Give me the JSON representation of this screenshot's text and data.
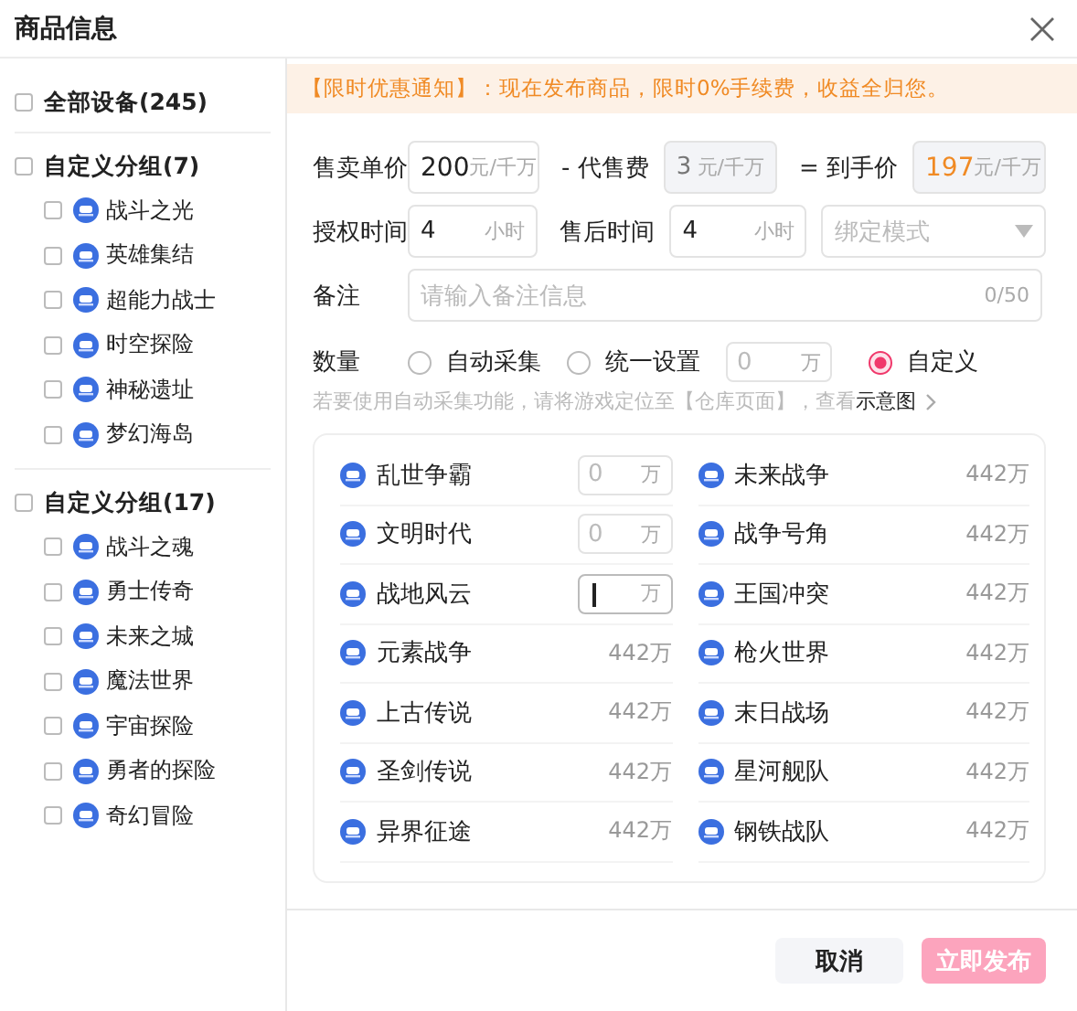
{
  "window": {
    "title": "商品信息"
  },
  "sidebar": {
    "all": {
      "label": "全部设备(245)",
      "checked": false
    },
    "groups": [
      {
        "label": "自定义分组(7)",
        "checked": false,
        "children": [
          {
            "label": "战斗之光",
            "checked": false
          },
          {
            "label": "英雄集结",
            "checked": false
          },
          {
            "label": "超能力战士",
            "checked": false
          },
          {
            "label": "时空探险",
            "checked": false
          },
          {
            "label": "神秘遗址",
            "checked": false
          },
          {
            "label": "梦幻海岛",
            "checked": false
          }
        ]
      },
      {
        "label": "自定义分组(17)",
        "checked": false,
        "children": [
          {
            "label": "战斗之魂",
            "checked": false
          },
          {
            "label": "勇士传奇",
            "checked": false
          },
          {
            "label": "未来之城",
            "checked": false
          },
          {
            "label": "魔法世界",
            "checked": false
          },
          {
            "label": "宇宙探险",
            "checked": false
          },
          {
            "label": "勇者的探险",
            "checked": false
          },
          {
            "label": "奇幻冒险",
            "checked": false
          }
        ]
      }
    ]
  },
  "notice": "【限时优惠通知】：现在发布商品，限时0%手续费，收益全归您。",
  "form": {
    "price": {
      "label": "售卖单价",
      "value": "200",
      "unit": "元/千万"
    },
    "fee": {
      "label": "- 代售费",
      "value": "3",
      "unit": "元/千万",
      "disabled": true
    },
    "net": {
      "label": "= 到手价",
      "value": "197",
      "unit": "元/千万",
      "disabled": true
    },
    "auth_time": {
      "label": "授权时间",
      "value": "4",
      "unit": "小时"
    },
    "after_sale": {
      "label": "售后时间",
      "value": "4",
      "unit": "小时"
    },
    "binding": {
      "placeholder": "绑定模式"
    },
    "remark": {
      "label": "备注",
      "placeholder": "请输入备注信息",
      "counter": "0/50"
    },
    "quantity": {
      "label": "数量",
      "options": [
        {
          "label": "自动采集",
          "selected": false
        },
        {
          "label": "统一设置",
          "selected": false,
          "input": {
            "placeholder": "0",
            "unit": "万"
          }
        },
        {
          "label": "自定义",
          "selected": true
        }
      ]
    },
    "hint": {
      "text": "若要使用自动采集功能，请将游戏定位至【仓库页面】，查看",
      "link": "示意图"
    }
  },
  "devices": [
    {
      "name": "乱世争霸",
      "kind": "input",
      "placeholder": "0",
      "unit": "万",
      "focused": false
    },
    {
      "name": "未来战争",
      "kind": "amount",
      "amount": "442万"
    },
    {
      "name": "文明时代",
      "kind": "input",
      "placeholder": "0",
      "unit": "万",
      "focused": false
    },
    {
      "name": "战争号角",
      "kind": "amount",
      "amount": "442万"
    },
    {
      "name": "战地风云",
      "kind": "input",
      "unit": "万",
      "focused": true
    },
    {
      "name": "王国冲突",
      "kind": "amount",
      "amount": "442万"
    },
    {
      "name": "元素战争",
      "kind": "amount",
      "amount": "442万"
    },
    {
      "name": "枪火世界",
      "kind": "amount",
      "amount": "442万"
    },
    {
      "name": "上古传说",
      "kind": "amount",
      "amount": "442万"
    },
    {
      "name": "末日战场",
      "kind": "amount",
      "amount": "442万"
    },
    {
      "name": "圣剑传说",
      "kind": "amount",
      "amount": "442万"
    },
    {
      "name": "星河舰队",
      "kind": "amount",
      "amount": "442万"
    },
    {
      "name": "异界征途",
      "kind": "amount",
      "amount": "442万"
    },
    {
      "name": "钢铁战队",
      "kind": "amount",
      "amount": "442万"
    }
  ],
  "buttons": [
    {
      "label": "取消",
      "kind": "secondary"
    },
    {
      "label": "立即发布",
      "kind": "primary",
      "disabled": true
    }
  ]
}
